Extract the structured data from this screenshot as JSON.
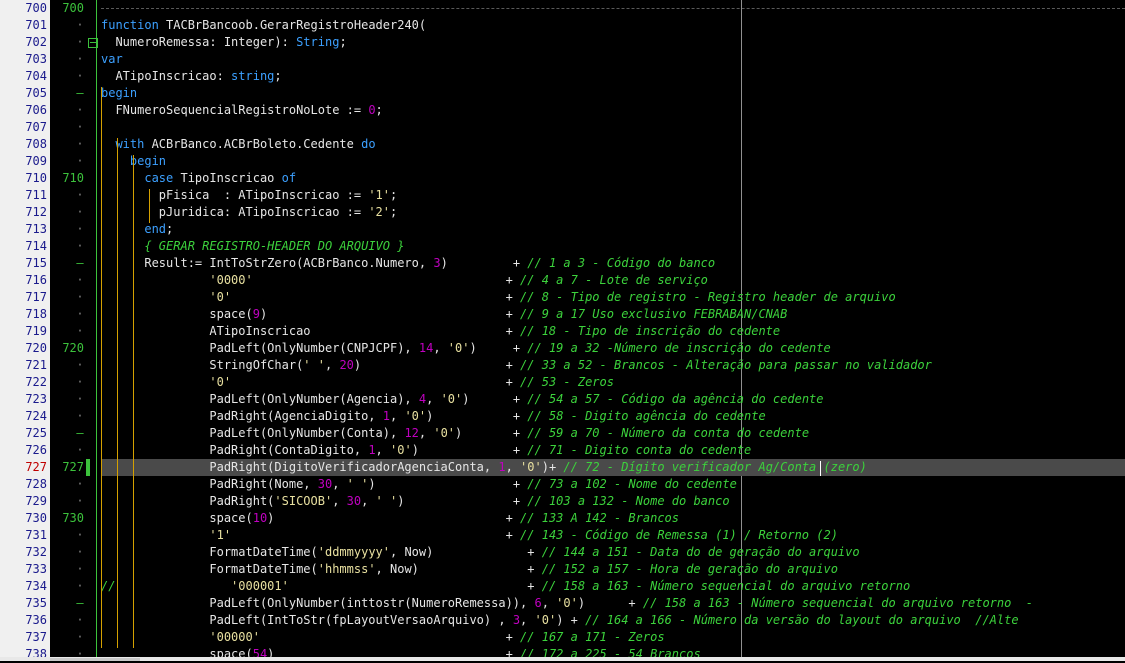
{
  "editor": {
    "lines": [
      {
        "no": "700",
        "gutter": "700",
        "segs": []
      },
      {
        "no": "701",
        "gutter": "·",
        "segs": [
          [
            "kw",
            "function "
          ],
          [
            "op",
            "TACBrBancoob.GerarRegistroHeader240("
          ]
        ]
      },
      {
        "no": "702",
        "gutter": "·",
        "segs": [
          [
            "op",
            "  NumeroRemessa: Integer): "
          ],
          [
            "type",
            "String"
          ],
          [
            "op",
            ";"
          ]
        ]
      },
      {
        "no": "703",
        "gutter": "·",
        "segs": [
          [
            "kw",
            "var"
          ]
        ]
      },
      {
        "no": "704",
        "gutter": "·",
        "segs": [
          [
            "op",
            "  ATipoInscricao: "
          ],
          [
            "type",
            "string"
          ],
          [
            "op",
            ";"
          ]
        ]
      },
      {
        "no": "705",
        "gutter": "–",
        "segs": [
          [
            "kw",
            "begin"
          ]
        ]
      },
      {
        "no": "706",
        "gutter": "·",
        "segs": [
          [
            "op",
            "  FNumeroSequencialRegistroNoLote := "
          ],
          [
            "num",
            "0"
          ],
          [
            "op",
            ";"
          ]
        ]
      },
      {
        "no": "707",
        "gutter": "·",
        "segs": []
      },
      {
        "no": "708",
        "gutter": "·",
        "segs": [
          [
            "op",
            "  "
          ],
          [
            "kw",
            "with "
          ],
          [
            "op",
            "ACBrBanco.ACBrBoleto.Cedente "
          ],
          [
            "kw",
            "do"
          ]
        ]
      },
      {
        "no": "709",
        "gutter": "·",
        "segs": [
          [
            "op",
            "    "
          ],
          [
            "kw",
            "begin"
          ]
        ]
      },
      {
        "no": "710",
        "gutter": "710",
        "segs": [
          [
            "op",
            "      "
          ],
          [
            "kw",
            "case "
          ],
          [
            "op",
            "TipoInscricao "
          ],
          [
            "kw",
            "of"
          ]
        ]
      },
      {
        "no": "711",
        "gutter": "·",
        "segs": [
          [
            "op",
            "        pFisica  : ATipoInscricao := "
          ],
          [
            "str",
            "'1'"
          ],
          [
            "op",
            ";"
          ]
        ]
      },
      {
        "no": "712",
        "gutter": "·",
        "segs": [
          [
            "op",
            "        pJuridica: ATipoInscricao := "
          ],
          [
            "str",
            "'2'"
          ],
          [
            "op",
            ";"
          ]
        ]
      },
      {
        "no": "713",
        "gutter": "·",
        "segs": [
          [
            "op",
            "      "
          ],
          [
            "kw",
            "end"
          ],
          [
            "op",
            ";"
          ]
        ]
      },
      {
        "no": "714",
        "gutter": "·",
        "segs": [
          [
            "op",
            "      "
          ],
          [
            "cm",
            "{ GERAR REGISTRO-HEADER DO ARQUIVO }"
          ]
        ]
      },
      {
        "no": "715",
        "gutter": "–",
        "segs": [
          [
            "op",
            "      Result:= IntToStrZero(ACBrBanco.Numero, "
          ],
          [
            "num",
            "3"
          ],
          [
            "op",
            ")         + "
          ],
          [
            "cm",
            "// 1 a 3 - Código do banco"
          ]
        ]
      },
      {
        "no": "716",
        "gutter": "·",
        "segs": [
          [
            "op",
            "               "
          ],
          [
            "str",
            "'0000'"
          ],
          [
            "op",
            "                                   + "
          ],
          [
            "cm",
            "// 4 a 7 - Lote de serviço"
          ]
        ]
      },
      {
        "no": "717",
        "gutter": "·",
        "segs": [
          [
            "op",
            "               "
          ],
          [
            "str",
            "'0'"
          ],
          [
            "op",
            "                                      + "
          ],
          [
            "cm",
            "// 8 - Tipo de registro - Registro header de arquivo"
          ]
        ]
      },
      {
        "no": "718",
        "gutter": "·",
        "segs": [
          [
            "op",
            "               space("
          ],
          [
            "num",
            "9"
          ],
          [
            "op",
            ")                                 + "
          ],
          [
            "cm",
            "// 9 a 17 Uso exclusivo FEBRABAN/CNAB"
          ]
        ]
      },
      {
        "no": "719",
        "gutter": "·",
        "segs": [
          [
            "op",
            "               ATipoInscricao                           + "
          ],
          [
            "cm",
            "// 18 - Tipo de inscrição do cedente"
          ]
        ]
      },
      {
        "no": "720",
        "gutter": "720",
        "segs": [
          [
            "op",
            "               PadLeft(OnlyNumber(CNPJCPF), "
          ],
          [
            "num",
            "14"
          ],
          [
            "op",
            ", "
          ],
          [
            "str",
            "'0'"
          ],
          [
            "op",
            ")     + "
          ],
          [
            "cm",
            "// 19 a 32 -Número de inscrição do cedente"
          ]
        ]
      },
      {
        "no": "721",
        "gutter": "·",
        "segs": [
          [
            "op",
            "               StringOfChar("
          ],
          [
            "str",
            "' '"
          ],
          [
            "op",
            ", "
          ],
          [
            "num",
            "20"
          ],
          [
            "op",
            ")                    + "
          ],
          [
            "cm",
            "// 33 a 52 - Brancos - Alteração para passar no validador"
          ]
        ]
      },
      {
        "no": "722",
        "gutter": "·",
        "segs": [
          [
            "op",
            "               "
          ],
          [
            "str",
            "'0'"
          ],
          [
            "op",
            "                                      + "
          ],
          [
            "cm",
            "// 53 - Zeros"
          ]
        ]
      },
      {
        "no": "723",
        "gutter": "·",
        "segs": [
          [
            "op",
            "               PadLeft(OnlyNumber(Agencia), "
          ],
          [
            "num",
            "4"
          ],
          [
            "op",
            ", "
          ],
          [
            "str",
            "'0'"
          ],
          [
            "op",
            ")      + "
          ],
          [
            "cm",
            "// 54 a 57 - Código da agência do cedente"
          ]
        ]
      },
      {
        "no": "724",
        "gutter": "·",
        "segs": [
          [
            "op",
            "               PadRight(AgenciaDigito, "
          ],
          [
            "num",
            "1"
          ],
          [
            "op",
            ", "
          ],
          [
            "str",
            "'0'"
          ],
          [
            "op",
            ")           + "
          ],
          [
            "cm",
            "// 58 - Digito agência do cedente"
          ]
        ]
      },
      {
        "no": "725",
        "gutter": "–",
        "segs": [
          [
            "op",
            "               PadLeft(OnlyNumber(Conta), "
          ],
          [
            "num",
            "12"
          ],
          [
            "op",
            ", "
          ],
          [
            "str",
            "'0'"
          ],
          [
            "op",
            ")       + "
          ],
          [
            "cm",
            "// 59 a 70 - Número da conta do cedente"
          ]
        ]
      },
      {
        "no": "726",
        "gutter": "·",
        "segs": [
          [
            "op",
            "               PadRight(ContaDigito, "
          ],
          [
            "num",
            "1"
          ],
          [
            "op",
            ", "
          ],
          [
            "str",
            "'0'"
          ],
          [
            "op",
            ")             + "
          ],
          [
            "cm",
            "// 71 - Digito conta do cedente"
          ]
        ]
      },
      {
        "no": "727",
        "gutter": "727",
        "segs": [
          [
            "op",
            "               PadRight(DigitoVerificadorAgenciaConta, "
          ],
          [
            "num",
            "1"
          ],
          [
            "op",
            ", "
          ],
          [
            "str",
            "'0'"
          ],
          [
            "op",
            ")+ "
          ],
          [
            "cm",
            "// 72 - Dígito verificador Ag/Conta (zero)"
          ]
        ]
      },
      {
        "no": "728",
        "gutter": "·",
        "segs": [
          [
            "op",
            "               PadRight(Nome, "
          ],
          [
            "num",
            "30"
          ],
          [
            "op",
            ", "
          ],
          [
            "str",
            "' '"
          ],
          [
            "op",
            ")                   + "
          ],
          [
            "cm",
            "// 73 a 102 - Nome do cedente"
          ]
        ]
      },
      {
        "no": "729",
        "gutter": "·",
        "segs": [
          [
            "op",
            "               PadRight("
          ],
          [
            "str",
            "'SICOOB'"
          ],
          [
            "op",
            ", "
          ],
          [
            "num",
            "30"
          ],
          [
            "op",
            ", "
          ],
          [
            "str",
            "' '"
          ],
          [
            "op",
            ")               + "
          ],
          [
            "cm",
            "// 103 a 132 - Nome do banco"
          ]
        ]
      },
      {
        "no": "730",
        "gutter": "730",
        "segs": [
          [
            "op",
            "               space("
          ],
          [
            "num",
            "10"
          ],
          [
            "op",
            ")                                + "
          ],
          [
            "cm",
            "// 133 A 142 - Brancos"
          ]
        ]
      },
      {
        "no": "731",
        "gutter": "·",
        "segs": [
          [
            "op",
            "               "
          ],
          [
            "str",
            "'1'"
          ],
          [
            "op",
            "                                      + "
          ],
          [
            "cm",
            "// 143 - Código de Remessa (1) / Retorno (2)"
          ]
        ]
      },
      {
        "no": "732",
        "gutter": "·",
        "segs": [
          [
            "op",
            "               FormatDateTime("
          ],
          [
            "str",
            "'ddmmyyyy'"
          ],
          [
            "op",
            ", Now)             + "
          ],
          [
            "cm",
            "// 144 a 151 - Data do de geração do arquivo"
          ]
        ]
      },
      {
        "no": "733",
        "gutter": "·",
        "segs": [
          [
            "op",
            "               FormatDateTime("
          ],
          [
            "str",
            "'hhmmss'"
          ],
          [
            "op",
            ", Now)               + "
          ],
          [
            "cm",
            "// 152 a 157 - Hora de geração do arquivo"
          ]
        ]
      },
      {
        "no": "734",
        "gutter": "·",
        "segs": [
          [
            "cm",
            "//"
          ],
          [
            "op",
            "                "
          ],
          [
            "str",
            "'000001'"
          ],
          [
            "op",
            "                                 + "
          ],
          [
            "cm",
            "// 158 a 163 - Número sequencial do arquivo retorno"
          ]
        ]
      },
      {
        "no": "735",
        "gutter": "–",
        "segs": [
          [
            "op",
            "               PadLeft(OnlyNumber(inttostr(NumeroRemessa)), "
          ],
          [
            "num",
            "6"
          ],
          [
            "op",
            ", "
          ],
          [
            "str",
            "'0'"
          ],
          [
            "op",
            ")      + "
          ],
          [
            "cm",
            "// 158 a 163 - Número sequencial do arquivo retorno  -"
          ]
        ]
      },
      {
        "no": "736",
        "gutter": "·",
        "segs": [
          [
            "op",
            "               PadLeft(IntToStr(fpLayoutVersaoArquivo) , "
          ],
          [
            "num",
            "3"
          ],
          [
            "op",
            ", "
          ],
          [
            "str",
            "'0'"
          ],
          [
            "op",
            ") + "
          ],
          [
            "cm",
            "// 164 a 166 - Número da versão do layout do arquivo  //Alte"
          ]
        ]
      },
      {
        "no": "737",
        "gutter": "·",
        "segs": [
          [
            "op",
            "               "
          ],
          [
            "str",
            "'00000'"
          ],
          [
            "op",
            "                                  + "
          ],
          [
            "cm",
            "// 167 a 171 - Zeros"
          ]
        ]
      },
      {
        "no": "738",
        "gutter": "·",
        "segs": [
          [
            "op",
            "               space("
          ],
          [
            "num",
            "54"
          ],
          [
            "op",
            ")                                + "
          ],
          [
            "cm",
            "// 172 a 225 - 54 Brancos"
          ]
        ]
      }
    ],
    "current_line": "727"
  }
}
